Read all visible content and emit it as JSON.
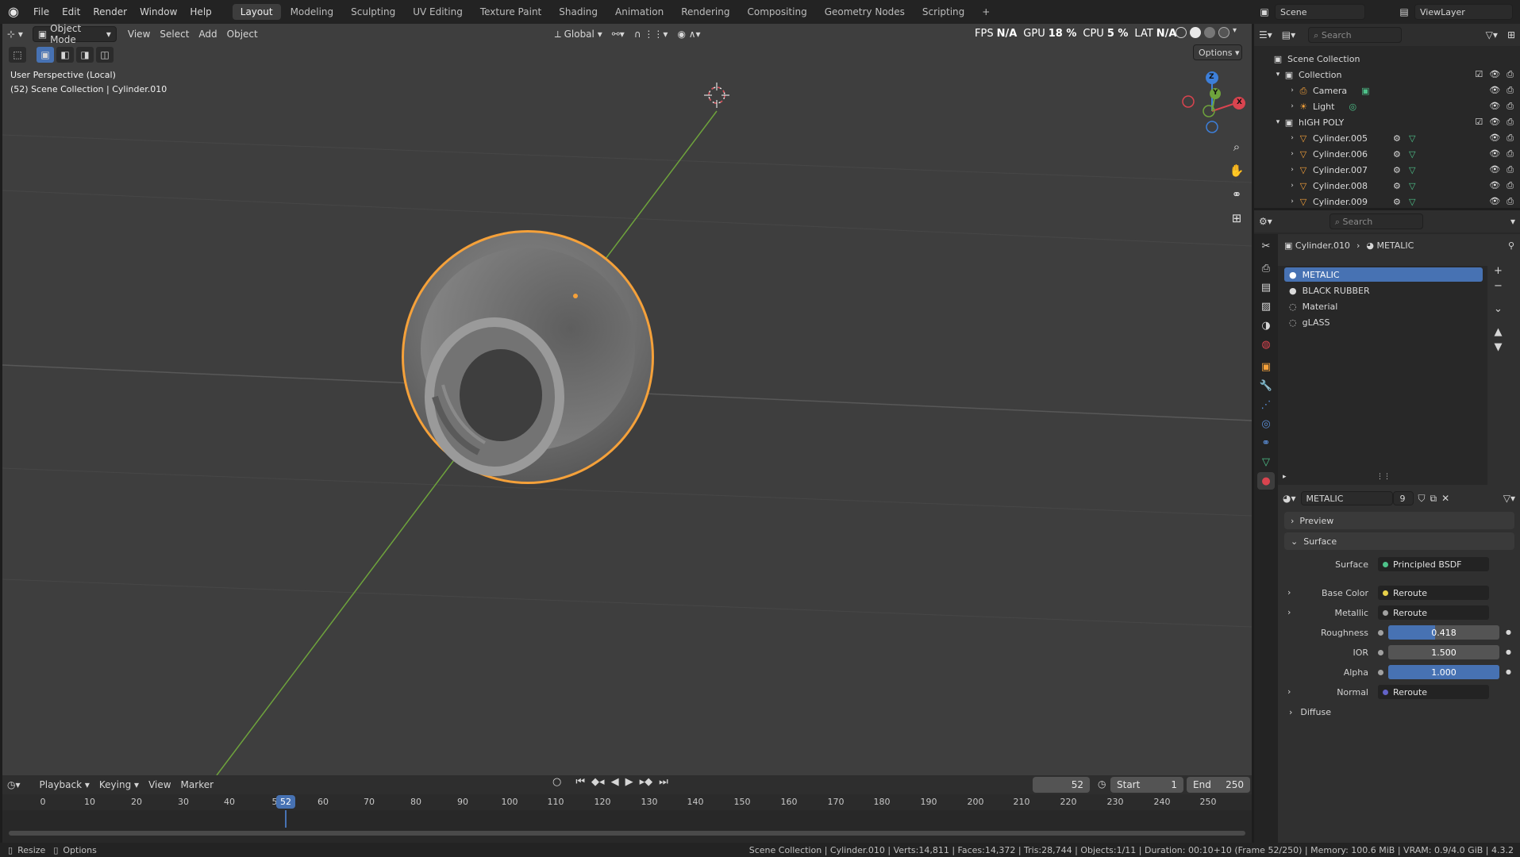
{
  "topbar": {
    "menus": [
      "File",
      "Edit",
      "Render",
      "Window",
      "Help"
    ],
    "workspaces": [
      "Layout",
      "Modeling",
      "Sculpting",
      "UV Editing",
      "Texture Paint",
      "Shading",
      "Animation",
      "Rendering",
      "Compositing",
      "Geometry Nodes",
      "Scripting"
    ],
    "add_tab": "+",
    "scene": "Scene",
    "view_layer": "ViewLayer"
  },
  "perf": {
    "fps_label": "FPS",
    "fps_value": "N/A",
    "gpu_label": "GPU",
    "gpu_value": "18 %",
    "cpu_label": "CPU",
    "cpu_value": "5 %",
    "lat_label": "LAT",
    "lat_value": "N/A"
  },
  "viewport": {
    "mode": "Object Mode",
    "menus": [
      "View",
      "Select",
      "Add",
      "Object"
    ],
    "transform_orientation": "Global",
    "options": "Options",
    "info_line1": "User Perspective (Local)",
    "info_line2": "(52) Scene Collection | Cylinder.010",
    "gizmo": {
      "z": "Z",
      "y": "Y",
      "x": "X"
    }
  },
  "outliner": {
    "search_placeholder": "Search",
    "rows": [
      {
        "label": "Scene Collection"
      },
      {
        "label": "Collection"
      },
      {
        "label": "Camera"
      },
      {
        "label": "Light"
      },
      {
        "label": "hIGH POLY"
      },
      {
        "label": "Cylinder.005"
      },
      {
        "label": "Cylinder.006"
      },
      {
        "label": "Cylinder.007"
      },
      {
        "label": "Cylinder.008"
      },
      {
        "label": "Cylinder.009"
      }
    ]
  },
  "properties": {
    "search_placeholder": "Search",
    "breadcrumb_object": "Cylinder.010",
    "breadcrumb_material": "METALIC",
    "slots": [
      "METALIC",
      "BLACK RUBBER",
      "Material",
      "gLASS"
    ],
    "material_name": "METALIC",
    "user_count": "9",
    "panels": {
      "preview": "Preview",
      "surface": "Surface",
      "diffuse": "Diffuse"
    },
    "surface": {
      "surface_label": "Surface",
      "surface_value": "Principled BSDF",
      "base_color_label": "Base Color",
      "base_color_value": "Reroute",
      "metallic_label": "Metallic",
      "metallic_value": "Reroute",
      "roughness_label": "Roughness",
      "roughness_value": "0.418",
      "roughness_fraction": 0.418,
      "ior_label": "IOR",
      "ior_value": "1.500",
      "alpha_label": "Alpha",
      "alpha_value": "1.000",
      "alpha_fraction": 1.0,
      "normal_label": "Normal",
      "normal_value": "Reroute"
    }
  },
  "timeline": {
    "menus": [
      "Playback",
      "Keying",
      "View",
      "Marker"
    ],
    "current_frame": "52",
    "start_label": "Start",
    "start_value": "1",
    "end_label": "End",
    "end_value": "250",
    "ticks": [
      "0",
      "10",
      "20",
      "30",
      "40",
      "5",
      "60",
      "70",
      "80",
      "90",
      "100",
      "110",
      "120",
      "130",
      "140",
      "150",
      "160",
      "170",
      "180",
      "190",
      "200",
      "210",
      "220",
      "230",
      "240",
      "250"
    ],
    "playhead_label": "52"
  },
  "statusbar": {
    "resize": "Resize",
    "options": "Options",
    "info": "Scene Collection | Cylinder.010 | Verts:14,811 | Faces:14,372 | Tris:28,744 | Objects:1/11 | Duration: 00:10+10 (Frame 52/250) | Memory: 100.6 MiB | VRAM: 0.9/4.0 GiB | 4.3.2"
  },
  "colors": {
    "accent": "#4772b3",
    "selection_outline": "#f5a13a",
    "x_axis": "#d9444f",
    "y_axis": "#6ea33c",
    "z_axis": "#3d7fd9"
  },
  "icons": [
    "blender-logo",
    "cursor-icon",
    "select-box-icon",
    "eye-icon",
    "camera-icon",
    "zoom-icon",
    "hand-icon",
    "camera-view-icon",
    "grid-icon",
    "pin-icon",
    "search-icon"
  ]
}
